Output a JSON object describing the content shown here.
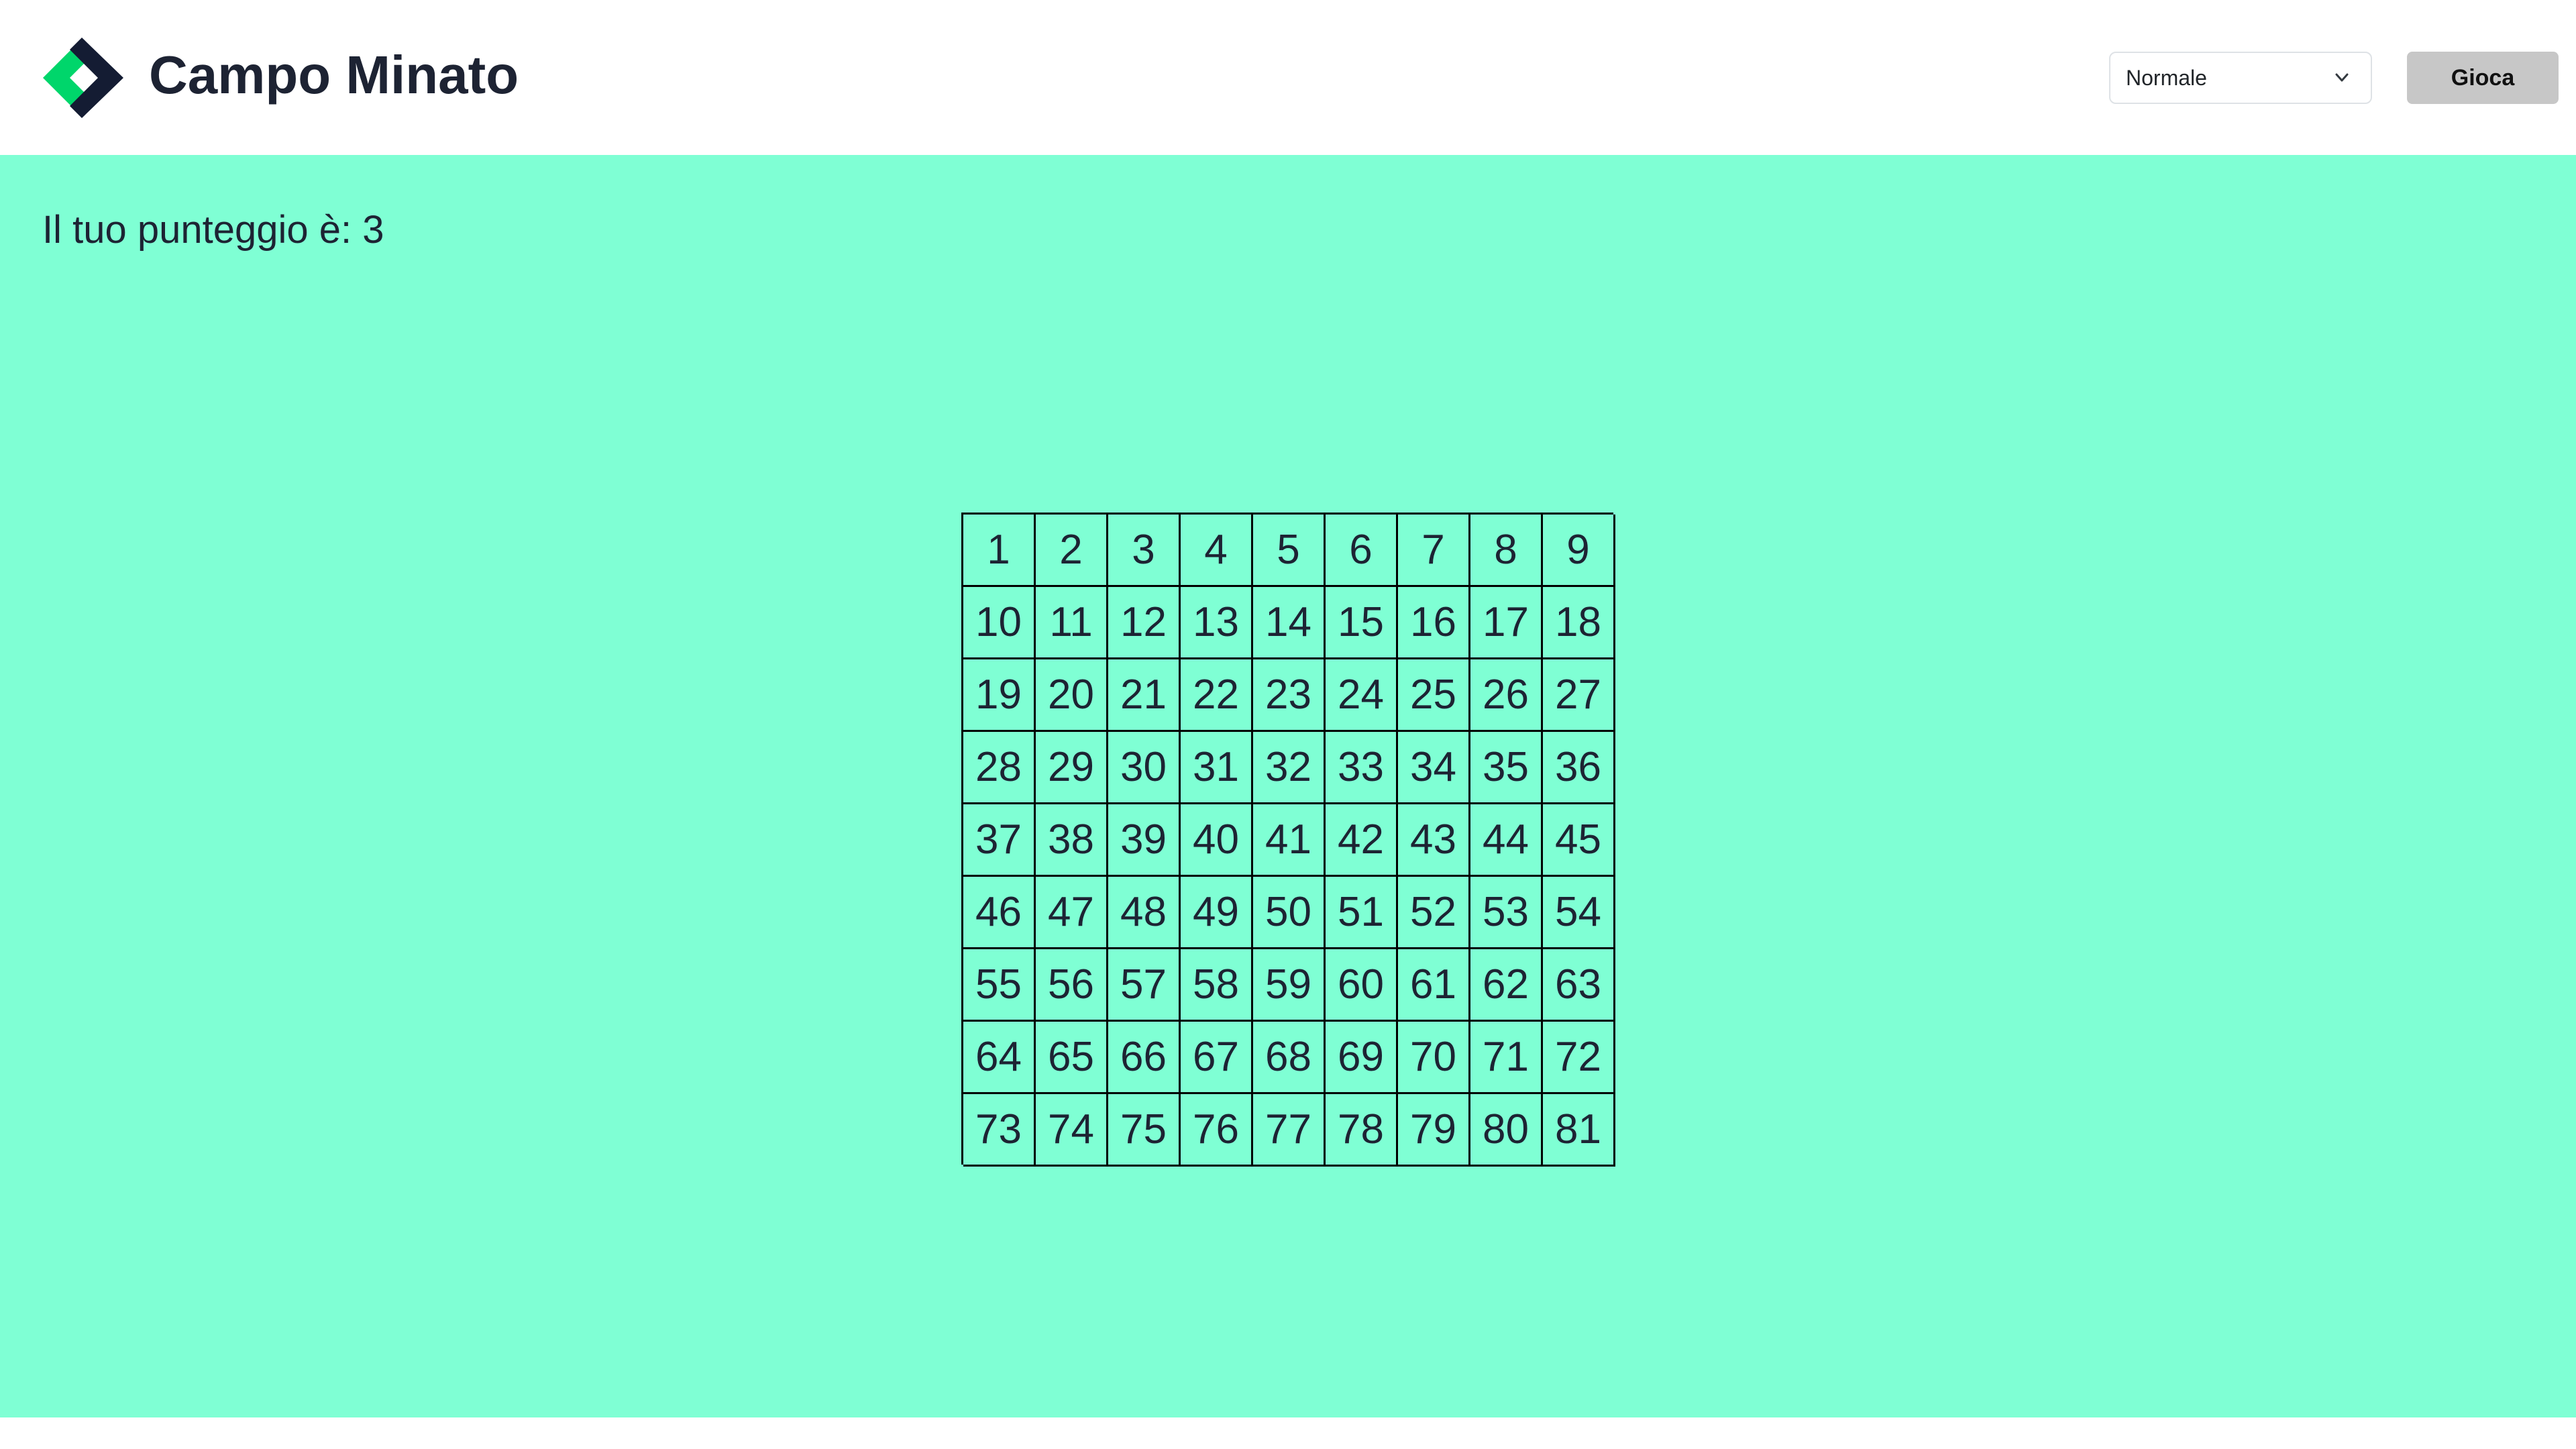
{
  "header": {
    "title": "Campo Minato",
    "logo_icon": "diamond-logo-icon",
    "difficulty": {
      "selected": "Normale",
      "icon": "chevron-down-icon"
    },
    "play_label": "Gioca"
  },
  "main": {
    "score_text": "Il tuo punteggio è: 3",
    "grid": {
      "rows": 9,
      "columns": 9,
      "cells": [
        "1",
        "2",
        "3",
        "4",
        "5",
        "6",
        "7",
        "8",
        "9",
        "10",
        "11",
        "12",
        "13",
        "14",
        "15",
        "16",
        "17",
        "18",
        "19",
        "20",
        "21",
        "22",
        "23",
        "24",
        "25",
        "26",
        "27",
        "28",
        "29",
        "30",
        "31",
        "32",
        "33",
        "34",
        "35",
        "36",
        "37",
        "38",
        "39",
        "40",
        "41",
        "42",
        "43",
        "44",
        "45",
        "46",
        "47",
        "48",
        "49",
        "50",
        "51",
        "52",
        "53",
        "54",
        "55",
        "56",
        "57",
        "58",
        "59",
        "60",
        "61",
        "62",
        "63",
        "64",
        "65",
        "66",
        "67",
        "68",
        "69",
        "70",
        "71",
        "72",
        "73",
        "74",
        "75",
        "76",
        "77",
        "78",
        "79",
        "80",
        "81"
      ]
    }
  },
  "colors": {
    "background": "#7fffd4",
    "header": "#ffffff",
    "logo_green": "#00d66b",
    "logo_navy": "#141c33",
    "button": "#c7c7c7",
    "cell_border": "#000000"
  }
}
